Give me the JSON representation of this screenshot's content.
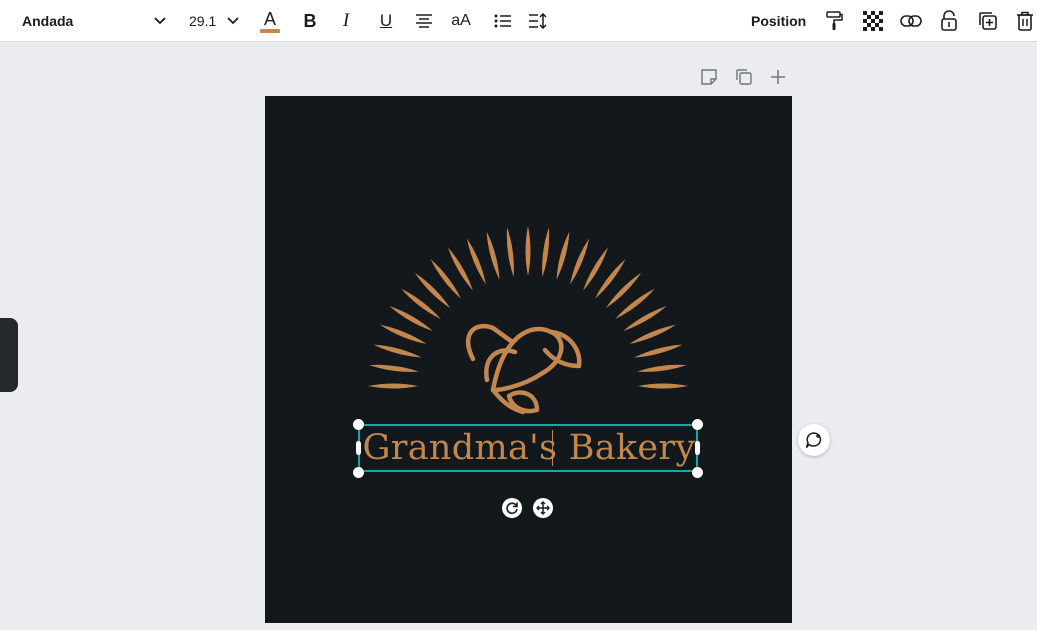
{
  "toolbar": {
    "font_family": "Andada",
    "font_size": "29.1",
    "position_label": "Position",
    "text_color": "#c3864c",
    "icons": [
      "text-color-icon",
      "bold-icon",
      "italic-icon",
      "underline-icon",
      "align-icon",
      "letter-case-icon",
      "list-icon",
      "spacing-icon",
      "paint-roller-icon",
      "transparency-icon",
      "link-icon",
      "lock-icon",
      "duplicate-icon",
      "trash-icon"
    ]
  },
  "page_actions": {
    "icons": [
      "note-icon",
      "copy-page-icon",
      "add-page-icon"
    ]
  },
  "canvas": {
    "background": "#13181c",
    "title_text": "Grandma's Bakery",
    "accent_color": "#c3864c",
    "selection_color": "#12aaa2"
  },
  "comment": {
    "icon": "add-comment-icon"
  }
}
